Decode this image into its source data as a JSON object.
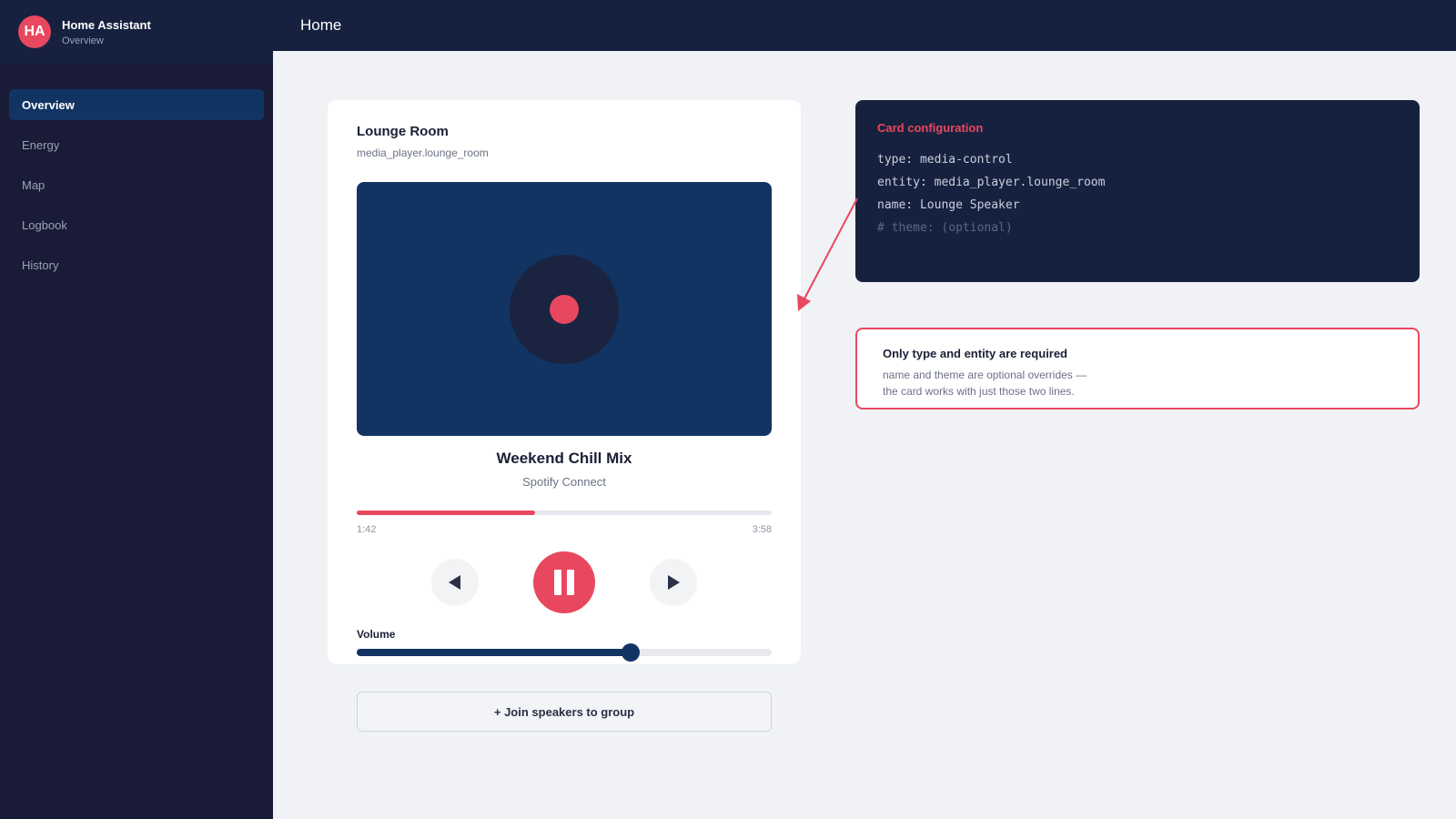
{
  "sidebar": {
    "brand": {
      "initials": "HA",
      "title": "Home Assistant",
      "subtitle": "Overview"
    },
    "items": [
      {
        "label": "Overview",
        "active": true
      },
      {
        "label": "Energy",
        "active": false
      },
      {
        "label": "Map",
        "active": false
      },
      {
        "label": "Logbook",
        "active": false
      },
      {
        "label": "History",
        "active": false
      }
    ]
  },
  "header": {
    "title": "Home"
  },
  "media_card": {
    "title": "Lounge Room",
    "entity": "media_player.lounge_room",
    "track": "Weekend Chill Mix",
    "source": "Spotify Connect",
    "elapsed": "1:42",
    "duration": "3:58",
    "progress_fraction": 0.43,
    "volume_label": "Volume",
    "volume_fraction": 0.66,
    "group_button": "+ Join speakers to group"
  },
  "config": {
    "title": "Card configuration",
    "lines": [
      "type: media-control",
      "entity: media_player.lounge_room",
      "name: Lounge Speaker",
      "# theme: (optional)"
    ]
  },
  "note": {
    "title": "Only type and entity are required",
    "lines": [
      "name and theme are optional overrides —",
      "the card works with just those two lines."
    ]
  },
  "colors": {
    "accent": "#e8485f",
    "navy": "#16213f",
    "sidebar": "#1a1b36",
    "active_nav": "#123463",
    "background": "#f0f2f5"
  },
  "icons": {
    "previous": "previous-track-icon",
    "play_pause": "pause-icon",
    "next": "next-track-icon",
    "album_art": "disc-icon"
  }
}
